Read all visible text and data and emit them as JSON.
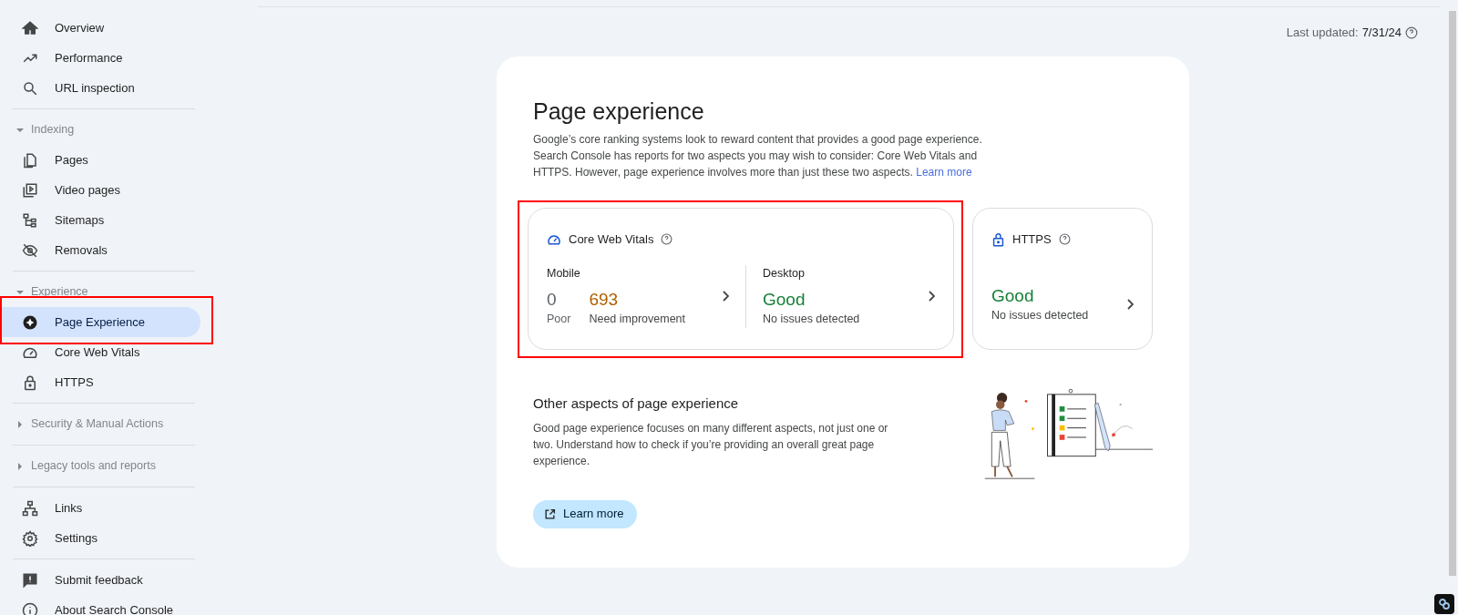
{
  "sidebar": {
    "groups": [
      {
        "items": [
          {
            "label": "Overview",
            "selected": false,
            "highlighted": false
          },
          {
            "label": "Performance",
            "selected": false,
            "highlighted": false
          },
          {
            "label": "URL inspection",
            "selected": false,
            "highlighted": false
          }
        ]
      },
      {
        "header": {
          "label": "Indexing",
          "expanded": true
        },
        "items": [
          {
            "label": "Pages",
            "selected": false,
            "highlighted": false
          },
          {
            "label": "Video pages",
            "selected": false,
            "highlighted": false
          },
          {
            "label": "Sitemaps",
            "selected": false,
            "highlighted": false
          },
          {
            "label": "Removals",
            "selected": false,
            "highlighted": false
          }
        ]
      },
      {
        "header": {
          "label": "Experience",
          "expanded": true
        },
        "items": [
          {
            "label": "Page Experience",
            "selected": true,
            "highlighted": true
          },
          {
            "label": "Core Web Vitals",
            "selected": false,
            "highlighted": false
          },
          {
            "label": "HTTPS",
            "selected": false,
            "highlighted": false
          }
        ]
      },
      {
        "header": {
          "label": "Security & Manual Actions",
          "expanded": false
        }
      },
      {
        "header": {
          "label": "Legacy tools and reports",
          "expanded": false
        }
      },
      {
        "items": [
          {
            "label": "Links",
            "selected": false,
            "highlighted": false
          },
          {
            "label": "Settings",
            "selected": false,
            "highlighted": false
          }
        ]
      },
      {
        "items": [
          {
            "label": "Submit feedback",
            "selected": false,
            "highlighted": false
          },
          {
            "label": "About Search Console",
            "selected": false,
            "highlighted": false
          }
        ]
      }
    ]
  },
  "last_updated": {
    "label": "Last updated:",
    "value": "7/31/24"
  },
  "page_experience": {
    "title": "Page experience",
    "description": "Google’s core ranking systems look to reward content that provides a good page experience. Search Console has reports for two aspects you may wish to consider: Core Web Vitals and HTTPS. However, page experience involves more than just these two aspects.",
    "link": "Learn more"
  },
  "core_web_vitals": {
    "title": "Core Web Vitals",
    "highlighted": true,
    "mobile": {
      "label": "Mobile",
      "poor": {
        "value": "0",
        "label": "Poor"
      },
      "needs_improvement": {
        "value": "693",
        "label": "Need improvement"
      }
    },
    "desktop": {
      "label": "Desktop",
      "status": "Good",
      "detail": "No issues detected"
    }
  },
  "https": {
    "title": "HTTPS",
    "status": "Good",
    "detail": "No issues detected"
  },
  "other_aspects": {
    "title": "Other aspects of page experience",
    "description": "Good page experience focuses on many different aspects, not just one or two. Understand how to check if you’re providing an overall great page experience.",
    "button": "Learn more"
  }
}
